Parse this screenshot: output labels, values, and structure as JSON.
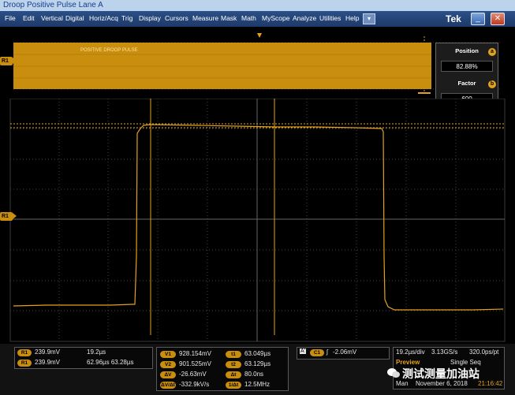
{
  "window": {
    "title": "Droop Positive Pulse Lane A"
  },
  "menu": {
    "items": [
      "File",
      "Edit",
      "Vertical",
      "Digital",
      "Horiz/Acq",
      "Trig",
      "Display",
      "Cursors",
      "Measure",
      "Mask",
      "Math",
      "MyScope",
      "Analyze",
      "Utilities",
      "Help"
    ],
    "dropdown_glyph": "▾",
    "logo": "Tek",
    "minimize_glyph": "_",
    "close_glyph": "✕"
  },
  "overview": {
    "label": "POSITIVE DROOP PULSE"
  },
  "markers": {
    "ref_overview": "R1",
    "ref_main": "R1"
  },
  "position_panel": {
    "position_title": "Position",
    "position_value": "82.88%",
    "position_knob": "a",
    "factor_title": "Factor",
    "factor_value": "600",
    "factor_knob": "b"
  },
  "cursor_readout": {
    "r1_label": "R1",
    "r1_value": "239.9mV",
    "r1_time": "19.2µs",
    "r1b_label": "R1",
    "r1b_value": "239.9mV",
    "r1b_times": "62.96µs 63.28µs"
  },
  "measurements": {
    "v1_label": "V1",
    "v1": "928.154mV",
    "v2_label": "V2",
    "v2": "901.525mV",
    "dv_label": "ΔV",
    "dv": "-26.63mV",
    "dvdt_label": "ΔV/Δt",
    "dvdt": "-332.9kV/s",
    "t1_label": "t1",
    "t1": "63.049µs",
    "t2_label": "t2",
    "t2": "63.129µs",
    "dt_label": "Δt",
    "dt": "80.0ns",
    "inv_label": "1/Δt",
    "inv": "12.5MHz"
  },
  "trigger": {
    "mode_label": "A'",
    "source_label": "C1",
    "slope": "ʃ",
    "level": "-2.06mV"
  },
  "acquisition": {
    "horizontal": "19.2µs/div",
    "sample_rate": "3.13GS/s",
    "record": "320.0ps/pt",
    "preview": "Preview",
    "mode": "Single Seq",
    "acq_mode": "Man",
    "date": "November 6, 2018",
    "time": "21:16:42"
  },
  "watermark": "测试测量加油站",
  "colors": {
    "trace": "#e2a21c",
    "band": "#c98e0e",
    "grid": "#4a4a4a",
    "menubar": "#23447a"
  }
}
